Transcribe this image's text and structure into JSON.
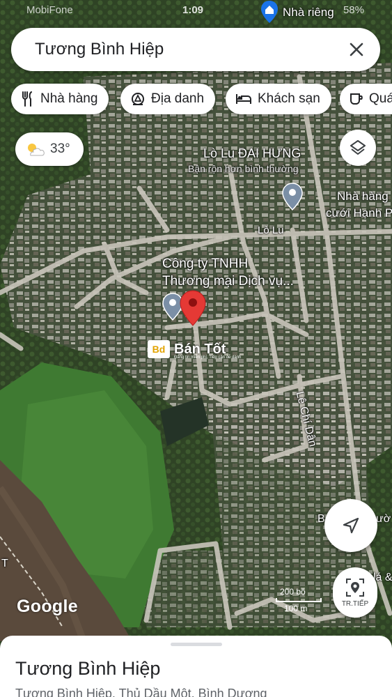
{
  "status_bar": {
    "carrier": "MobiFone",
    "time": "1:09",
    "battery": "58%"
  },
  "search": {
    "query": "Tương Bình Hiệp"
  },
  "chips": [
    {
      "label": "Nhà hàng",
      "icon": "restaurant-icon"
    },
    {
      "label": "Địa danh",
      "icon": "landmark-icon"
    },
    {
      "label": "Khách sạn",
      "icon": "hotel-icon"
    },
    {
      "label": "Quá",
      "icon": "coffee-icon"
    }
  ],
  "weather": {
    "temperature": "33°",
    "icon": "partly-cloudy-icon"
  },
  "map_labels": {
    "home_label": "Nhà riêng",
    "poi_1_name": "Lò Lu ĐẠI HƯNG",
    "poi_1_status": "Bận rộn hơn bình thường",
    "poi_2_line1": "Nhà hàng",
    "poi_2_line2": "cưới Hạnh P",
    "road_lo_lu": "Lò Lu",
    "company_line1": "Công ty TNHH",
    "company_line2": "Thương mại Dịch vụ...",
    "road_le_chi_dan": "Lê Chí Dân",
    "edge_label_1": "B",
    "edge_label_2": "ườ",
    "edge_label_3": "lá &",
    "edge_label_4": "T"
  },
  "watermark": {
    "logo": "Bd",
    "brand": "Bán Tốt",
    "tagline": "Đăng tin miễn phí, Tiếp cận dễ dành"
  },
  "map_controls": {
    "go_label": "TR.TIẾP"
  },
  "attribution": "Google",
  "scale": {
    "top": "200 bộ",
    "bottom": "100 m"
  },
  "place": {
    "title": "Tương Bình Hiệp",
    "subtitle": "Tương Bình Hiệp, Thủ Dầu Một, Bình Dương"
  },
  "colors": {
    "pin": "#e53935",
    "map_pin": "#7b8fa6",
    "river": "#5a4a3c",
    "grass": "#3d6e2f"
  }
}
